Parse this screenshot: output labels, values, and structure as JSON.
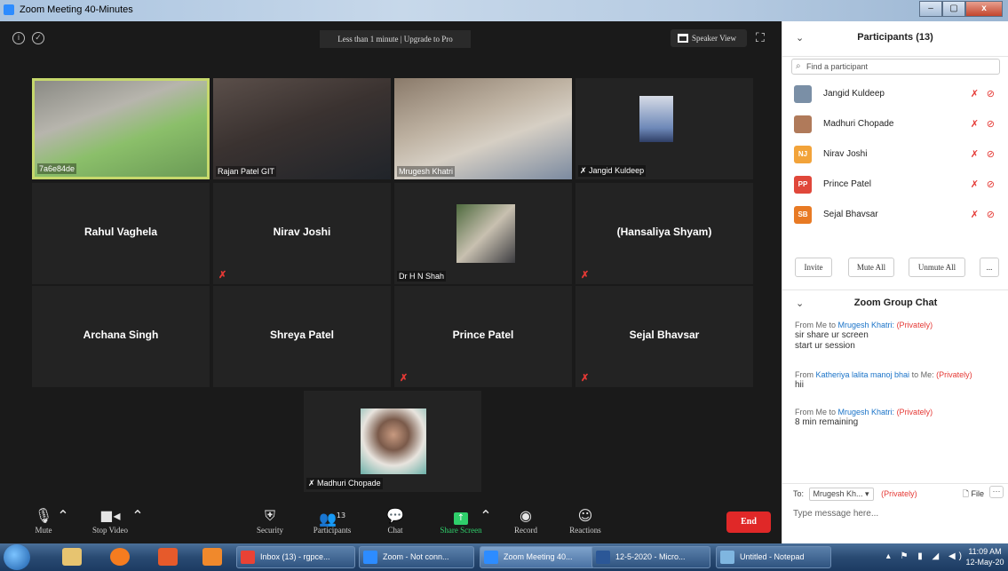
{
  "window": {
    "title": "Zoom Meeting 40-Minutes",
    "minimize": "–",
    "restore": "▢",
    "close": "x"
  },
  "meeting": {
    "timer_text": "Less than 1 minute | Upgrade to Pro",
    "speaker_view_label": "Speaker View",
    "tiles": [
      {
        "name": "7a6e84de",
        "type": "video",
        "muted": false,
        "active": true
      },
      {
        "name": "Rajan Patel GIT",
        "type": "video",
        "muted": false
      },
      {
        "name": "Mrugesh Khatri",
        "type": "video",
        "muted": false
      },
      {
        "name": "Jangid Kuldeep",
        "type": "photo",
        "muted": true
      },
      {
        "name": "Rahul Vaghela",
        "type": "text",
        "muted": false
      },
      {
        "name": "Nirav Joshi",
        "type": "text",
        "muted": true
      },
      {
        "name": "Dr H N Shah",
        "type": "photo",
        "muted": false
      },
      {
        "name": "(Hansaliya Shyam)",
        "type": "text",
        "muted": true
      },
      {
        "name": "Archana Singh",
        "type": "text",
        "muted": false
      },
      {
        "name": "Shreya Patel",
        "type": "text",
        "muted": false
      },
      {
        "name": "Prince Patel",
        "type": "text",
        "muted": true
      },
      {
        "name": "Sejal Bhavsar",
        "type": "text",
        "muted": true
      },
      {
        "name": "Madhuri Chopade",
        "type": "photo",
        "muted": true
      }
    ]
  },
  "toolbar": {
    "mute": "Mute",
    "stop_video": "Stop Video",
    "security": "Security",
    "participants": "Participants",
    "participants_count": "13",
    "chat": "Chat",
    "share_screen": "Share Screen",
    "record": "Record",
    "reactions": "Reactions",
    "end": "End"
  },
  "participants_panel": {
    "title": "Participants (13)",
    "search_placeholder": "Find a participant",
    "list": [
      {
        "name": "Jangid Kuldeep",
        "initials": "",
        "color": "#7a8fa6"
      },
      {
        "name": "Madhuri Chopade",
        "initials": "",
        "color": "#b07a5a"
      },
      {
        "name": "Nirav Joshi",
        "initials": "NJ",
        "color": "#f2a33a"
      },
      {
        "name": "Prince Patel",
        "initials": "PP",
        "color": "#e0473a"
      },
      {
        "name": "Sejal Bhavsar",
        "initials": "SB",
        "color": "#e87a24"
      }
    ],
    "invite": "Invite",
    "mute_all": "Mute All",
    "unmute_all": "Unmute All",
    "more": "..."
  },
  "chat": {
    "title": "Zoom Group Chat",
    "messages": [
      {
        "from": "From Me to ",
        "to": "Mrugesh Khatri:",
        "priv": "(Privately)",
        "lines": [
          "sir share ur screen",
          "start ur session"
        ]
      },
      {
        "from": "From ",
        "to": "Katheriya lalita manoj bhai",
        "mid": " to Me: ",
        "priv": "(Privately)",
        "lines": [
          "hii"
        ]
      },
      {
        "from": "From Me to ",
        "to": "Mrugesh Khatri:",
        "priv": "(Privately)",
        "lines": [
          "8 min remaining"
        ]
      }
    ],
    "to_label": "To:",
    "to_value": "Mrugesh Kh... ▾",
    "priv_label": "(Privately)",
    "file_label": "File",
    "more": "···",
    "input_placeholder": "Type message here..."
  },
  "taskbar": {
    "tasks": [
      {
        "label": "Inbox (13) - rgpce...",
        "color": "#e94235"
      },
      {
        "label": "Zoom - Not conn...",
        "color": "#2d8cff"
      },
      {
        "label": "Zoom Meeting 40...",
        "color": "#2d8cff"
      },
      {
        "label": "12-5-2020 - Micro...",
        "color": "#2b5797"
      },
      {
        "label": "Untitled - Notepad",
        "color": "#7fb6e0"
      }
    ],
    "clock_time": "11:09 AM",
    "clock_date": "12-May-20"
  }
}
